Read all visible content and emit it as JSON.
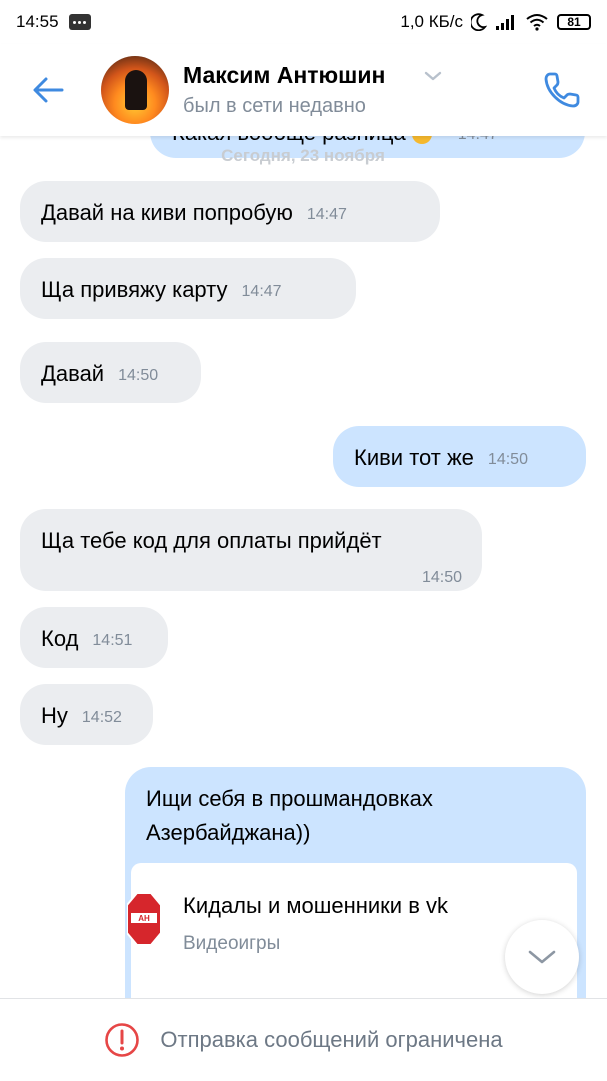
{
  "status_bar": {
    "time": "14:55",
    "network_speed": "1,0 КБ/с",
    "battery": "81",
    "icons": [
      "notification-dots-icon",
      "moon-icon",
      "signal-icon",
      "wifi-icon",
      "battery-icon"
    ]
  },
  "header": {
    "name": "Максим Антюшин",
    "status": "был в сети недавно"
  },
  "chat": {
    "partial_message": {
      "text": "Какая вообще разница",
      "time": "14:47"
    },
    "date_separator": "Сегодня, 23 ноября",
    "messages": [
      {
        "dir": "in",
        "text": "Давай на киви попробую",
        "time": "14:47"
      },
      {
        "dir": "in",
        "text": "Ща привяжу карту",
        "time": "14:47"
      },
      {
        "dir": "in",
        "text": "Давай",
        "time": "14:50"
      },
      {
        "dir": "out",
        "text": "Киви тот же",
        "time": "14:50"
      },
      {
        "dir": "in",
        "text": "Ща тебе код для оплаты прийдёт",
        "time": "14:50"
      },
      {
        "dir": "in",
        "text": "Код",
        "time": "14:51"
      },
      {
        "dir": "in",
        "text": "Ну",
        "time": "14:52"
      },
      {
        "dir": "out",
        "text_line1": "Ищи себя в прошмандовках",
        "text_line2": "Азербайджана))"
      }
    ],
    "attachment": {
      "title": "Кидалы и мошенники в vk",
      "subtitle": "Видеоигры",
      "icon": "stop-sign-icon"
    }
  },
  "bottom_bar": {
    "text": "Отправка сообщений ограничена"
  },
  "colors": {
    "accent": "#3f8ae0",
    "incoming_bubble": "#ebedf0",
    "outgoing_bubble": "#cce4ff",
    "secondary_text": "#818c99",
    "warning": "#e64646"
  }
}
